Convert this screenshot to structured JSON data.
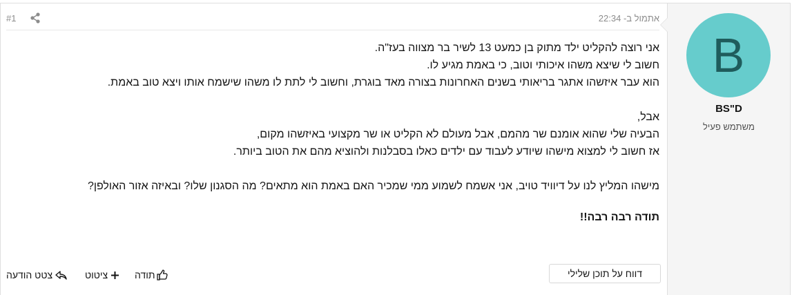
{
  "user": {
    "avatar_letter": "B",
    "name": "BS\"D",
    "title": "משתמש פעיל",
    "avatar_color": "#66cccc"
  },
  "post": {
    "date": "אתמול ב- 22:34",
    "number": "#1",
    "share_icon": "share-icon",
    "lines": [
      "אני רוצה להקליט ילד מתוק בן כמעט 13 לשיר בר מצווה בעז\"ה.",
      "חשוב לי שיצא משהו איכותי וטוב, כי באמת מגיע לו.",
      "הוא עבר איזשהו אתגר בריאותי בשנים האחרונות בצורה מאד בוגרת, וחשוב לי לתת לו משהו שישמח אותו ויצא טוב באמת.",
      "",
      "אבל,",
      "הבעיה שלי שהוא אומנם שר מהמם, אבל מעולם לא הקליט או שר מקצועי באיזשהו מקום,",
      "אז חשוב לי למצוא מישהו שיודע לעבוד עם ילדים כאלו בסבלנות ולהוציא מהם את הטוב ביותר.",
      "",
      "מישהו המליץ לנו על דיוויד טויב, אני אשמח לשמוע ממי שמכיר האם באמת הוא מתאים? מה הסגנון שלו? ובאיזה אזור האולפן?"
    ],
    "thanks": "תודה רבה רבה!!"
  },
  "actions": {
    "report": "דווח על תוכן שלילי",
    "like": "תודה",
    "quote": "ציטוט",
    "reply": "צטט הודעה"
  }
}
